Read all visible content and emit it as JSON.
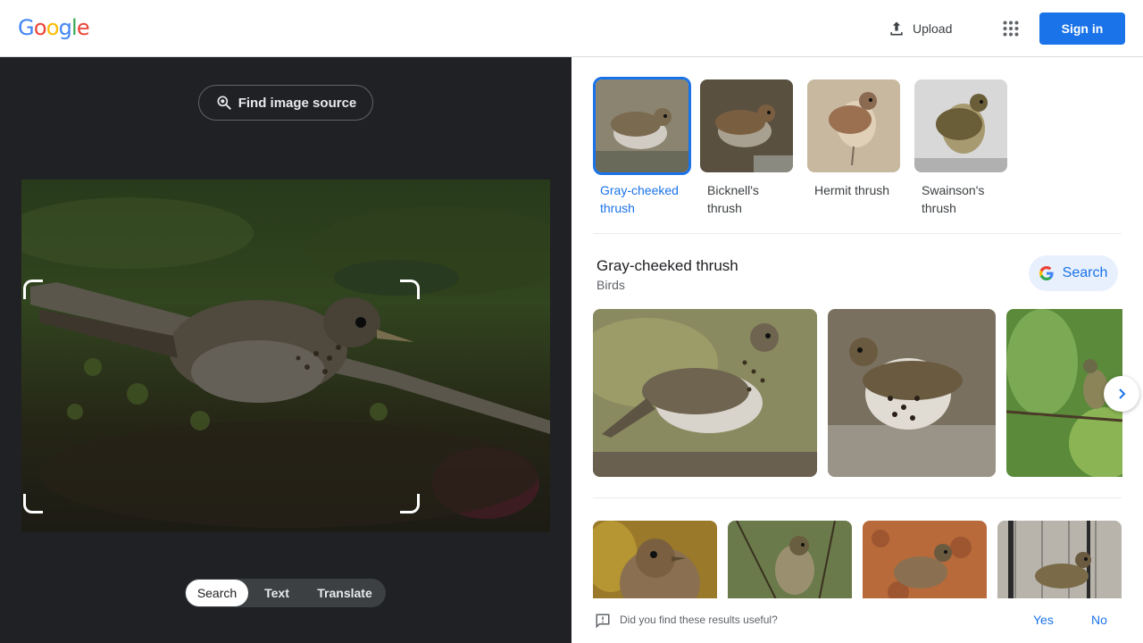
{
  "header": {
    "logo_text": "Google",
    "upload_label": "Upload",
    "signin_label": "Sign in"
  },
  "left": {
    "find_source_label": "Find image source",
    "modes": [
      "Search",
      "Text",
      "Translate"
    ],
    "active_mode": "Search"
  },
  "related": {
    "chips": [
      {
        "label": "Gray-cheeked thrush",
        "active": true
      },
      {
        "label": "Bicknell's thrush",
        "active": false
      },
      {
        "label": "Hermit thrush",
        "active": false
      },
      {
        "label": "Swainson's thrush",
        "active": false
      }
    ]
  },
  "result": {
    "title": "Gray-cheeked thrush",
    "subtitle": "Birds",
    "search_label": "Search"
  },
  "feedback": {
    "question": "Did you find these results useful?",
    "yes": "Yes",
    "no": "No"
  },
  "colors": {
    "accent": "#1a73e8",
    "dark_panel": "#202124"
  }
}
